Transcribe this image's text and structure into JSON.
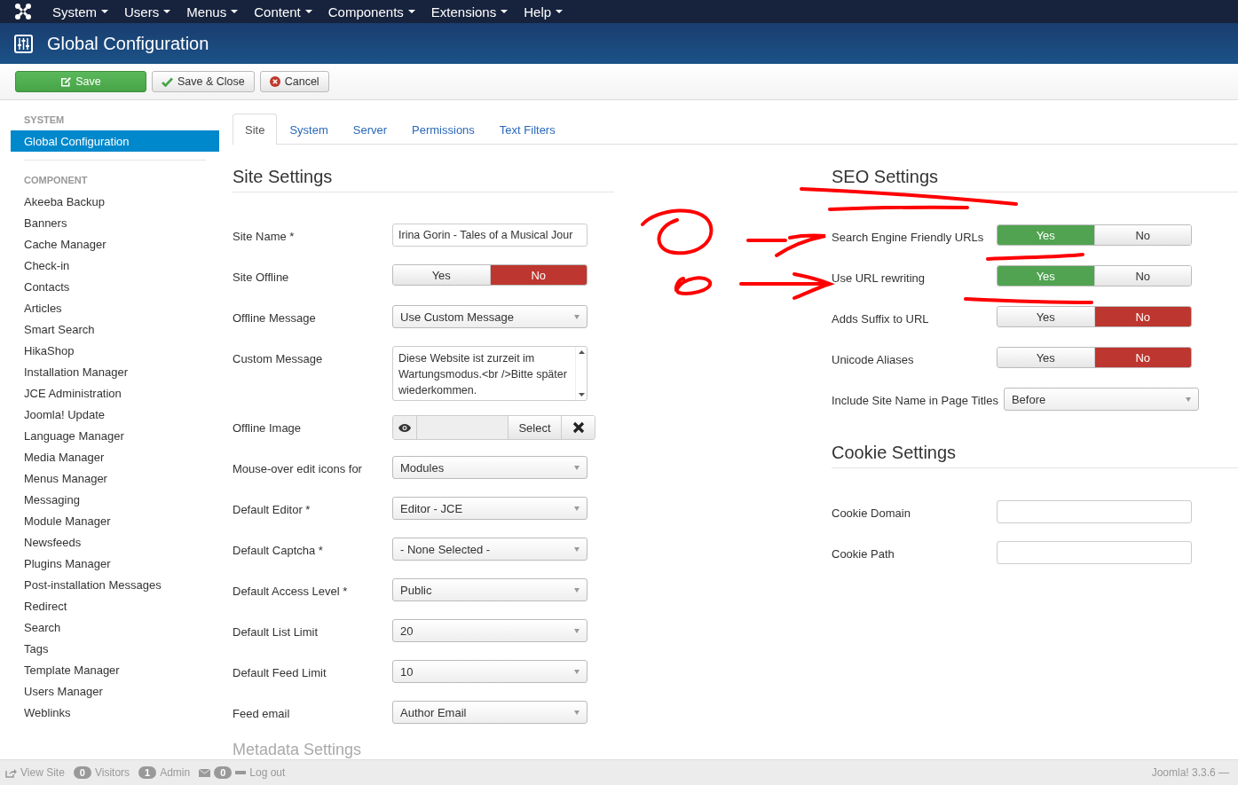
{
  "nav": {
    "menus": [
      {
        "label": "System"
      },
      {
        "label": "Users"
      },
      {
        "label": "Menus"
      },
      {
        "label": "Content"
      },
      {
        "label": "Components"
      },
      {
        "label": "Extensions"
      },
      {
        "label": "Help"
      }
    ]
  },
  "header": {
    "title": "Global Configuration"
  },
  "toolbar": {
    "buttons": [
      {
        "label": "Save",
        "kind": "save"
      },
      {
        "label": "Save & Close",
        "kind": "check"
      },
      {
        "label": "Cancel",
        "kind": "cancel"
      }
    ]
  },
  "sidebar": {
    "sections": [
      {
        "heading": "SYSTEM",
        "items": [
          {
            "label": "Global Configuration",
            "selected": true
          }
        ]
      },
      {
        "heading": "COMPONENT",
        "items": [
          {
            "label": "Akeeba Backup",
            "selected": false
          },
          {
            "label": "Banners",
            "selected": false
          },
          {
            "label": "Cache Manager",
            "selected": false
          },
          {
            "label": "Check-in",
            "selected": false
          },
          {
            "label": "Contacts",
            "selected": false
          },
          {
            "label": "Articles",
            "selected": false
          },
          {
            "label": "Smart Search",
            "selected": false
          },
          {
            "label": "HikaShop",
            "selected": false
          },
          {
            "label": "Installation Manager",
            "selected": false
          },
          {
            "label": "JCE Administration",
            "selected": false
          },
          {
            "label": "Joomla! Update",
            "selected": false
          },
          {
            "label": "Language Manager",
            "selected": false
          },
          {
            "label": "Media Manager",
            "selected": false
          },
          {
            "label": "Menus Manager",
            "selected": false
          },
          {
            "label": "Messaging",
            "selected": false
          },
          {
            "label": "Module Manager",
            "selected": false
          },
          {
            "label": "Newsfeeds",
            "selected": false
          },
          {
            "label": "Plugins Manager",
            "selected": false
          },
          {
            "label": "Post-installation Messages",
            "selected": false
          },
          {
            "label": "Redirect",
            "selected": false
          },
          {
            "label": "Search",
            "selected": false
          },
          {
            "label": "Tags",
            "selected": false
          },
          {
            "label": "Template Manager",
            "selected": false
          },
          {
            "label": "Users Manager",
            "selected": false
          },
          {
            "label": "Weblinks",
            "selected": false
          }
        ]
      }
    ]
  },
  "tabs": [
    {
      "label": "Site",
      "selected": true
    },
    {
      "label": "System",
      "selected": false
    },
    {
      "label": "Server",
      "selected": false
    },
    {
      "label": "Permissions",
      "selected": false
    },
    {
      "label": "Text Filters",
      "selected": false
    }
  ],
  "site_settings": {
    "title": "Site Settings",
    "fields": [
      {
        "label": "Site Name *",
        "kind": "text",
        "value": "Irina Gorin - Tales of a Musical Jour"
      },
      {
        "label": "Site Offline",
        "kind": "toggle",
        "options": [
          {
            "label": "Yes",
            "selected": false
          },
          {
            "label": "No",
            "selected": true
          }
        ]
      },
      {
        "label": "Offline Message",
        "kind": "select",
        "value": "Use Custom Message"
      },
      {
        "label": "Custom Message",
        "kind": "textarea",
        "value": "Diese Website ist zurzeit im Wartungsmodus.<br />Bitte später wiederkommen."
      },
      {
        "label": "Offline Image",
        "kind": "media",
        "button": "Select"
      },
      {
        "label": "Mouse-over edit icons for",
        "kind": "select",
        "value": "Modules"
      },
      {
        "label": "Default Editor *",
        "kind": "select",
        "value": "Editor - JCE"
      },
      {
        "label": "Default Captcha *",
        "kind": "select",
        "value": "- None Selected -"
      },
      {
        "label": "Default Access Level *",
        "kind": "select",
        "value": "Public"
      },
      {
        "label": "Default List Limit",
        "kind": "select",
        "value": "20"
      },
      {
        "label": "Default Feed Limit",
        "kind": "select",
        "value": "10"
      },
      {
        "label": "Feed email",
        "kind": "select",
        "value": "Author Email"
      }
    ]
  },
  "metadata_settings": {
    "title": "Metadata Settings"
  },
  "seo_settings": {
    "title": "SEO Settings",
    "fields": [
      {
        "label": "Search Engine Friendly URLs",
        "kind": "toggle",
        "options": [
          {
            "label": "Yes",
            "selected": true
          },
          {
            "label": "No",
            "selected": false
          }
        ]
      },
      {
        "label": "Use URL rewriting",
        "kind": "toggle",
        "options": [
          {
            "label": "Yes",
            "selected": true
          },
          {
            "label": "No",
            "selected": false
          }
        ]
      },
      {
        "label": "Adds Suffix to URL",
        "kind": "toggle",
        "options": [
          {
            "label": "Yes",
            "selected": false
          },
          {
            "label": "No",
            "selected": true
          }
        ]
      },
      {
        "label": "Unicode Aliases",
        "kind": "toggle",
        "options": [
          {
            "label": "Yes",
            "selected": false
          },
          {
            "label": "No",
            "selected": true
          }
        ]
      },
      {
        "label": "Include Site Name in Page Titles",
        "kind": "select",
        "value": "Before"
      }
    ]
  },
  "cookie_settings": {
    "title": "Cookie Settings",
    "fields": [
      {
        "label": "Cookie Domain",
        "kind": "text"
      },
      {
        "label": "Cookie Path",
        "kind": "text"
      }
    ]
  },
  "status_bar": {
    "view_site": "View Site",
    "visitors_count": "0",
    "visitors": "Visitors",
    "admin_count": "1",
    "admin": "Admin",
    "messages_count": "0",
    "logout": "Log out",
    "version": "Joomla! 3.3.6 —"
  }
}
